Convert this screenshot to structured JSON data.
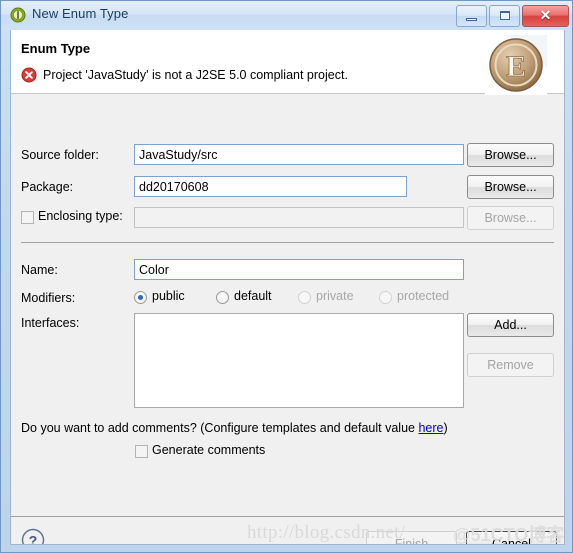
{
  "window": {
    "title": "New Enum Type",
    "title_icon": "enum-type-icon",
    "controls": {
      "minimize": "minimize-button",
      "maximize": "restore-button",
      "close": "close-button"
    }
  },
  "header": {
    "title": "Enum Type",
    "message": "Project 'JavaStudy' is not a J2SE 5.0 compliant project.",
    "message_icon": "error-icon",
    "banner_icon": "enum-banner-icon",
    "banner_letter": "E"
  },
  "form": {
    "source_folder": {
      "label": "Source folder:",
      "value": "JavaStudy/src",
      "browse": "Browse..."
    },
    "package": {
      "label": "Package:",
      "value": "dd20170608",
      "browse": "Browse..."
    },
    "enclosing_type": {
      "label": "Enclosing type:",
      "value": "",
      "checked": false,
      "browse": "Browse...",
      "enabled": false
    },
    "name": {
      "label": "Name:",
      "value": "Color"
    },
    "modifiers": {
      "label": "Modifiers:",
      "options": [
        {
          "label": "public",
          "selected": true,
          "enabled": true
        },
        {
          "label": "default",
          "selected": false,
          "enabled": true
        },
        {
          "label": "private",
          "selected": false,
          "enabled": false
        },
        {
          "label": "protected",
          "selected": false,
          "enabled": false
        }
      ]
    },
    "interfaces": {
      "label": "Interfaces:",
      "items": [],
      "add": "Add...",
      "remove": "Remove"
    }
  },
  "comments": {
    "question_prefix": "Do you want to add comments? (Configure templates and default value ",
    "link": "here",
    "question_suffix": ")",
    "checkbox_label": "Generate comments",
    "checked": false
  },
  "footer": {
    "help": "?",
    "finish": "Finish",
    "finish_enabled": false,
    "cancel": "Cancel"
  },
  "watermark": {
    "url": "http://blog.csdn.net/",
    "brand": "@51CTO博客"
  }
}
